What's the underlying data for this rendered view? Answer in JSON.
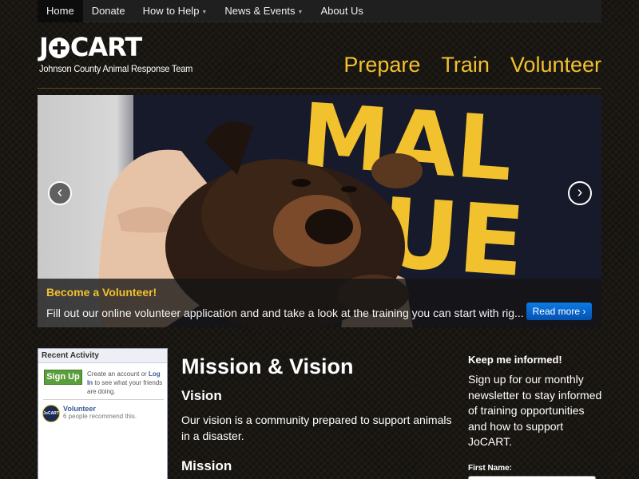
{
  "topnav": {
    "items": [
      {
        "label": "Home",
        "active": true,
        "dropdown": false
      },
      {
        "label": "Donate",
        "active": false,
        "dropdown": false
      },
      {
        "label": "How to Help",
        "active": false,
        "dropdown": true
      },
      {
        "label": "News & Events",
        "active": false,
        "dropdown": true
      },
      {
        "label": "About Us",
        "active": false,
        "dropdown": false
      }
    ]
  },
  "logo": {
    "part1": "J",
    "part2": "CART",
    "subtitle": "Johnson County Animal Response Team"
  },
  "mainnav": {
    "items": [
      "Prepare",
      "Train",
      "Volunteer"
    ]
  },
  "carousel": {
    "shirt_text_line1": "MAL",
    "shirt_text_line2": "UE",
    "caption_title": "Become a Volunteer!",
    "caption_text": "Fill out our online volunteer application and and take a look at the training you can start with rig...",
    "read_more": "Read more ›",
    "prev_icon": "chevron-left-icon",
    "next_icon": "chevron-right-icon"
  },
  "facebook": {
    "header": "Recent Activity",
    "signup_button": "Sign Up",
    "text_before": "Create an account or",
    "login_link": "Log In",
    "text_after": "to see what your friends are doing.",
    "avatar_text": "JoCART",
    "page_name": "Volunteer",
    "recommend_text": "6 people recommend this."
  },
  "mission": {
    "title": "Mission & Vision",
    "vision_heading": "Vision",
    "vision_text": "Our vision is a community prepared to support animals in a disaster.",
    "mission_heading": "Mission"
  },
  "signup": {
    "heading": "Keep me informed!",
    "text": "Sign up for our monthly newsletter to stay informed of training opportunities and how to support JoCART.",
    "first_name_label": "First Name:",
    "first_name_value": ""
  },
  "colors": {
    "accent_gold": "#f2c12e",
    "button_blue": "#0b7be4",
    "facebook_green": "#5b9f3c",
    "facebook_blue": "#3b5998",
    "background": "#1a1712"
  }
}
